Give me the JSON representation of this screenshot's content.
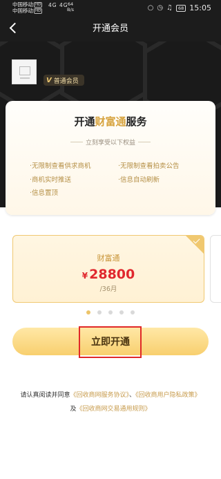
{
  "status_bar": {
    "carrier1": "中国移动",
    "carrier2": "中国移动",
    "hd": "HD",
    "signal": "4G 4G",
    "speed_value": "64",
    "speed_unit": "B/s",
    "battery": "68",
    "time": "15:05",
    "icons": [
      "signal-icon",
      "wifi-icon",
      "alarm-icon",
      "mute-icon",
      "battery-icon"
    ]
  },
  "header": {
    "title": "开通会员",
    "back_icon": "back-arrow-icon"
  },
  "profile": {
    "badge_mark": "V",
    "badge_label": "普通会员"
  },
  "promo": {
    "title_prefix": "开通",
    "title_highlight": "财富通",
    "title_suffix": "服务",
    "subtitle": "立刻享受以下权益",
    "benefits": [
      "·无限制查看供求商机",
      "·无限制查看拍卖公告",
      "·商机实时推送",
      "·信息自动刷新",
      "·信息置顶"
    ]
  },
  "plan": {
    "name": "财富通",
    "currency": "¥",
    "price": "28800",
    "period": "/36月",
    "selected": true
  },
  "pager": {
    "count": 5,
    "active_index": 0
  },
  "cta": {
    "label": "立即开通"
  },
  "agreement": {
    "prefix": "请认真阅读并同意",
    "link1": "《回收商网服务协议》",
    "sep": "、",
    "link2": "《回收商用户隐私政策》",
    "and": "及",
    "link3": "《回收商网交易通用规则》"
  },
  "colors": {
    "dark_bg": "#1a1a1a",
    "gold": "#d7a33e",
    "price_red": "#e0282e",
    "cta_gold": "#f8cf6e",
    "highlight_box": "#e02828"
  }
}
